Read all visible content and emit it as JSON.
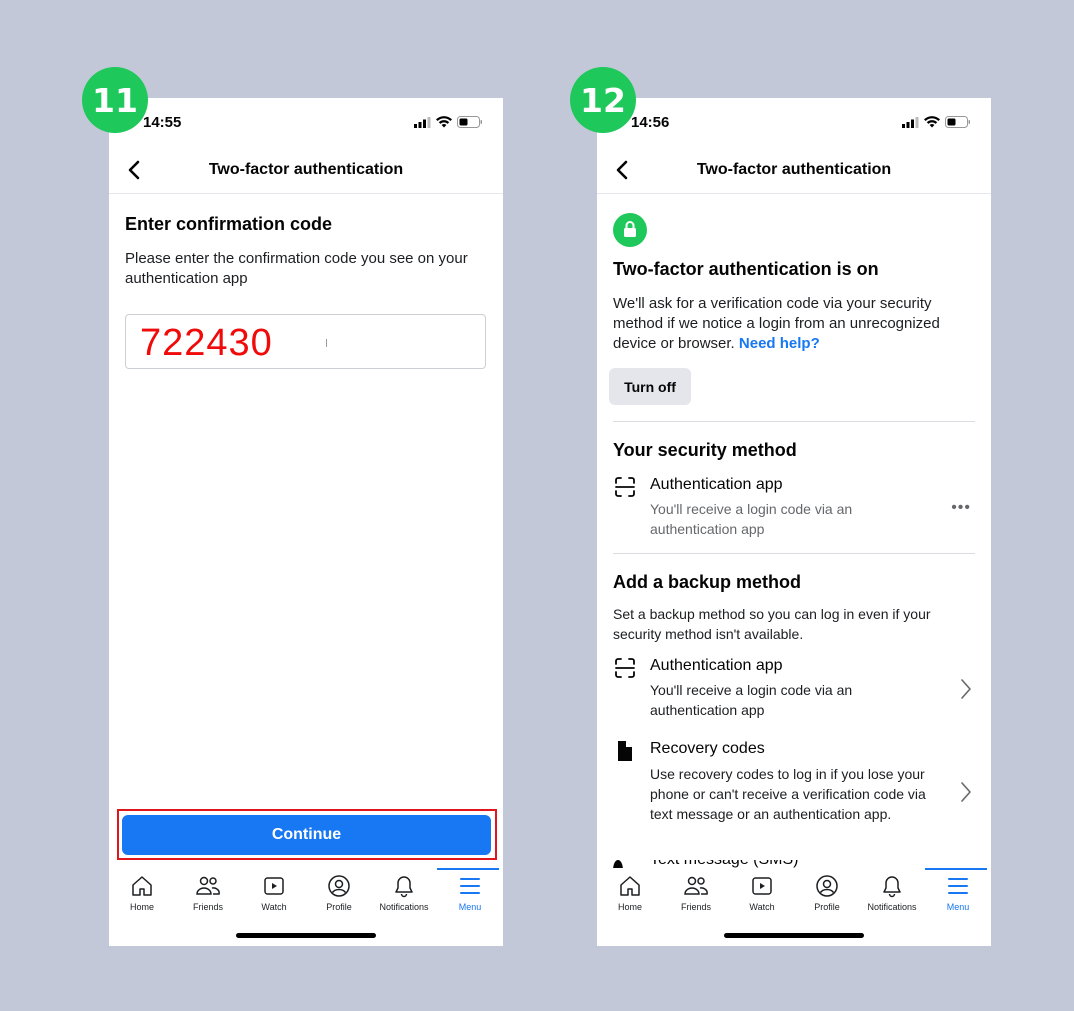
{
  "steps": [
    {
      "badge": "11",
      "status_time": "14:55",
      "header_title": "Two-factor authentication",
      "enter_title": "Enter confirmation code",
      "enter_desc": "Please enter the confirmation code you see on your authentication app",
      "code_value": "722430",
      "continue_label": "Continue"
    },
    {
      "badge": "12",
      "status_time": "14:56",
      "header_title": "Two-factor authentication",
      "on_title": "Two-factor authentication is on",
      "on_desc": "We'll ask for a verification code via your security method if we notice a login from an unrecognized device or browser.",
      "need_help": "Need help?",
      "turn_off_label": "Turn off",
      "security_title": "Your security method",
      "security_method": {
        "title": "Authentication app",
        "subtitle": "You'll receive a login code via an authentication app",
        "more": "•••"
      },
      "backup_title": "Add a backup method",
      "backup_desc": "Set a backup method so you can log in even if your security method isn't available.",
      "backup_methods": [
        {
          "title": "Authentication app",
          "subtitle": "You'll receive a login code via an authentication app"
        },
        {
          "title": "Recovery codes",
          "subtitle": "Use recovery codes to log in if you lose your phone or can't receive a verification code via text message or an authentication app."
        }
      ],
      "partial_text": "Text message (SMS)"
    }
  ],
  "tabs": [
    {
      "label": "Home",
      "icon": "home-icon"
    },
    {
      "label": "Friends",
      "icon": "friends-icon"
    },
    {
      "label": "Watch",
      "icon": "watch-icon"
    },
    {
      "label": "Profile",
      "icon": "profile-icon"
    },
    {
      "label": "Notifications",
      "icon": "bell-icon"
    },
    {
      "label": "Menu",
      "icon": "menu-icon",
      "active": true
    }
  ],
  "colors": {
    "background": "#c3c8d8",
    "badge": "#1ec85a",
    "accent": "#1877f2",
    "code": "#f00a0a",
    "highlight": "#e0161c"
  }
}
